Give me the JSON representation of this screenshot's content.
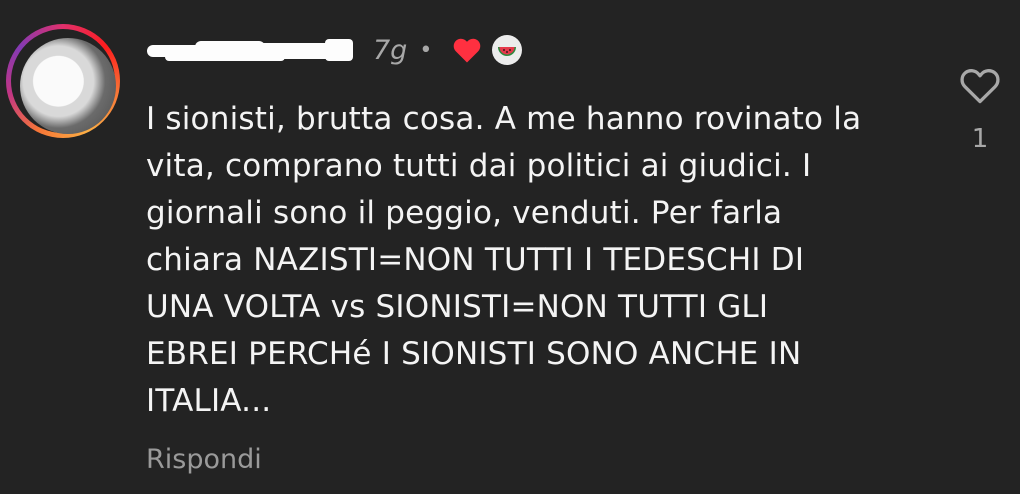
{
  "comment": {
    "username": "",
    "timestamp": "7g",
    "separator": "•",
    "text": "I sionisti, brutta cosa. A me hanno rovinato la\nvita, comprano tutti dai politici ai giudici. I\ngiornali sono il peggio, venduti. Per farla\nchiara NAZISTI=NON TUTTI I TEDESCHI DI\nUNA VOLTA vs SIONISTI=NON TUTTI GLI\nEBREI PERCHé I SIONISTI SONO ANCHE IN\nITALIA...",
    "reply_label": "Rispondi",
    "like_count": "1",
    "liked_by_creator": true
  },
  "icons": {
    "like": "heart-outline-icon",
    "creator_like": "heart-filled-icon",
    "creator_badge": "watermelon-icon"
  },
  "colors": {
    "background": "#232323",
    "text": "#f4f4f4",
    "muted": "#a8a8a8",
    "heart_red": "#ff3040"
  }
}
